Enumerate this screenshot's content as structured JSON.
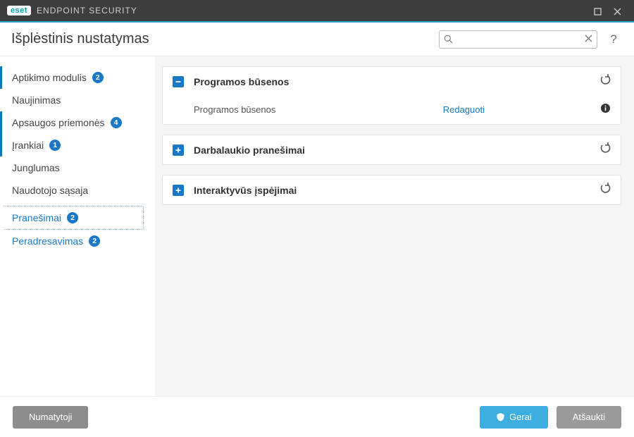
{
  "brand": {
    "logo": "eset",
    "product": "ENDPOINT SECURITY"
  },
  "header": {
    "title": "Išplėstinis nustatymas",
    "search_placeholder": ""
  },
  "sidebar": {
    "items": [
      {
        "label": "Aptikimo modulis",
        "badge": "2"
      },
      {
        "label": "Naujinimas",
        "badge": ""
      },
      {
        "label": "Apsaugos priemonės",
        "badge": "4"
      },
      {
        "label": "Įrankiai",
        "badge": "1"
      },
      {
        "label": "Junglumas",
        "badge": ""
      },
      {
        "label": "Naudotojo sąsaja",
        "badge": ""
      }
    ],
    "sub": [
      {
        "label": "Pranešimai",
        "badge": "2"
      },
      {
        "label": "Peradresavimas",
        "badge": "2"
      }
    ]
  },
  "panels": [
    {
      "title": "Programos būsenos",
      "expanded": true,
      "row": {
        "label": "Programos būsenos",
        "action": "Redaguoti"
      }
    },
    {
      "title": "Darbalaukio pranešimai",
      "expanded": false
    },
    {
      "title": "Interaktyvūs įspėjimai",
      "expanded": false
    }
  ],
  "footer": {
    "defaults": "Numatytoji",
    "ok": "Gerai",
    "cancel": "Atšaukti"
  }
}
